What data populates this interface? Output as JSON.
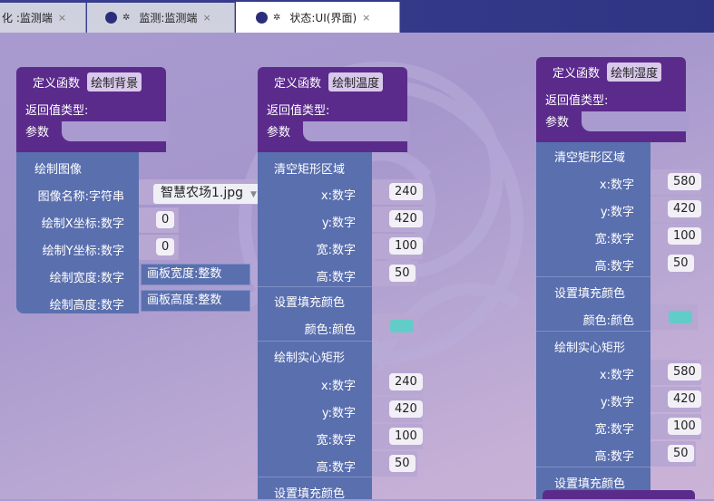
{
  "tabs": [
    {
      "label": "化 :监测端"
    },
    {
      "label": "监测:监测端"
    },
    {
      "label": "状态:UI(界面)"
    }
  ],
  "tab_close": "×",
  "tab_icon": "bug-icon",
  "common": {
    "define_fn": "定义函数",
    "return_type": "返回值类型:",
    "params": "参数",
    "x_num": "x:数字",
    "y_num": "y:数字",
    "w_num": "宽:数字",
    "h_num": "高:数字",
    "clear_rect": "清空矩形区域",
    "set_fill": "设置填充颜色",
    "color_label": "颜色:颜色",
    "fill_rect": "绘制实心矩形"
  },
  "bg": {
    "name": "绘制背景",
    "draw_image": "绘制图像",
    "image_name_label": "图像名称:字符串",
    "image_value": "智慧农场1.jpg",
    "x_label": "绘制X坐标:数字",
    "x_value": "0",
    "y_label": "绘制Y坐标:数字",
    "y_value": "0",
    "w_label": "绘制宽度:数字",
    "w_value": "画板宽度:整数",
    "h_label": "绘制高度:数字",
    "h_value": "画板高度:整数"
  },
  "temp": {
    "name": "绘制温度",
    "clear": {
      "x": "240",
      "y": "420",
      "w": "100",
      "h": "50"
    },
    "fill": {
      "x": "240",
      "y": "420",
      "w": "100",
      "h": "50"
    }
  },
  "hum": {
    "name": "绘制湿度",
    "clear": {
      "x": "580",
      "y": "420",
      "w": "100",
      "h": "50"
    },
    "fill": {
      "x": "580",
      "y": "420",
      "w": "100",
      "h": "50"
    }
  },
  "colors": {
    "fill_color": "#62ccc8",
    "block_header": "#5b2b8c",
    "block_body": "#5a6fae"
  }
}
